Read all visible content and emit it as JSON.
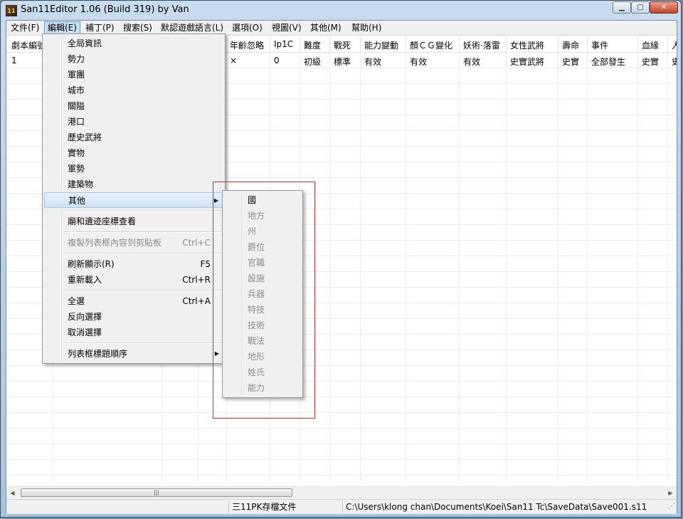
{
  "window": {
    "title": "San11Editor 1.06 (Build 319) by Van",
    "min_glyph": "▁",
    "max_glyph": "□",
    "close_glyph": "✕",
    "icon_text": "11"
  },
  "menubar": [
    "文件(F)",
    "編輯(E)",
    "補丁(P)",
    "搜索(S)",
    "默認遊戲語言(L)",
    "選項(O)",
    "視圖(V)",
    "其他(M)",
    "幫助(H)"
  ],
  "table": {
    "headers": [
      "劇本編號",
      "年齡忽略",
      "Ip1C",
      "難度",
      "戰死",
      "能力變動",
      "顏ＣＧ變化",
      "妖術·落雷",
      "女性武將",
      "壽命",
      "事件",
      "血緣",
      "人"
    ],
    "row": [
      "1",
      "×",
      "0",
      "初級",
      "標準",
      "有效",
      "有效",
      "有效",
      "史實武將",
      "史實",
      "全部發生",
      "史實",
      "史"
    ]
  },
  "edit_menu": {
    "items": [
      {
        "label": "全局資訊"
      },
      {
        "label": "勢力"
      },
      {
        "label": "軍團"
      },
      {
        "label": "城市"
      },
      {
        "label": "關隘"
      },
      {
        "label": "港口"
      },
      {
        "label": "歷史武將"
      },
      {
        "label": "實物"
      },
      {
        "label": "軍勢"
      },
      {
        "label": "建築物"
      },
      {
        "label": "其他"
      },
      {
        "label": "廟和遺迹座標查看"
      },
      {
        "label": "複製列表框內容到剪貼板",
        "shortcut": "Ctrl+C"
      },
      {
        "label": "刷新顯示(R)",
        "shortcut": "F5"
      },
      {
        "label": "重新載入",
        "shortcut": "Ctrl+R"
      },
      {
        "label": "全選",
        "shortcut": "Ctrl+A"
      },
      {
        "label": "反向選擇"
      },
      {
        "label": "取消選擇"
      },
      {
        "label": "列表框標題順序"
      }
    ],
    "submenu_arrow": "▶"
  },
  "submenu": [
    "國",
    "地方",
    "州",
    "爵位",
    "官職",
    "設施",
    "兵器",
    "特技",
    "技術",
    "戰法",
    "地形",
    "姓氏",
    "能力"
  ],
  "scrollbar": {
    "left_arrow": "◀",
    "right_arrow": "▶",
    "thumb_grip": "|||"
  },
  "status": {
    "file_type": "三11PK存檔文件",
    "path": "C:\\Users\\klong chan\\Documents\\Koei\\San11 Tc\\SaveData\\Save001.s11",
    "grip": "⋰"
  }
}
